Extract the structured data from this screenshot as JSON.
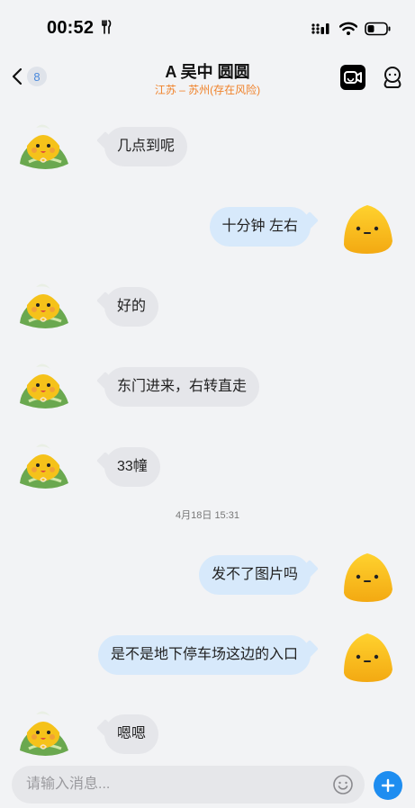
{
  "status": {
    "time": "00:52"
  },
  "header": {
    "back_count": "8",
    "title": "A 吴中 圆圆",
    "subtitle": "江苏 – 苏州(存在风险)"
  },
  "messages": [
    {
      "side": "in",
      "text": "几点到呢"
    },
    {
      "side": "out",
      "text": "十分钟 左右"
    },
    {
      "side": "in",
      "text": "好的"
    },
    {
      "side": "in",
      "text": "东门进来，右转直走"
    },
    {
      "side": "in",
      "text": "33幢"
    },
    {
      "side": "out",
      "text": "发不了图片吗"
    },
    {
      "side": "out",
      "text": "是不是地下停车场这边的入口"
    },
    {
      "side": "in",
      "text": "嗯嗯"
    }
  ],
  "timestamp": "4月18日 15:31",
  "input": {
    "placeholder": "请输入消息..."
  },
  "colors": {
    "accent": "#1e8df0",
    "warning": "#f0822a",
    "incoming_bubble": "#e5e6ea",
    "outgoing_bubble": "#d7e9fb"
  },
  "icons": [
    "fork-knife-icon",
    "signal-icon",
    "wifi-icon",
    "battery-icon",
    "back-chevron-icon",
    "video-call-icon",
    "profile-icon",
    "emoji-icon",
    "plus-icon"
  ]
}
